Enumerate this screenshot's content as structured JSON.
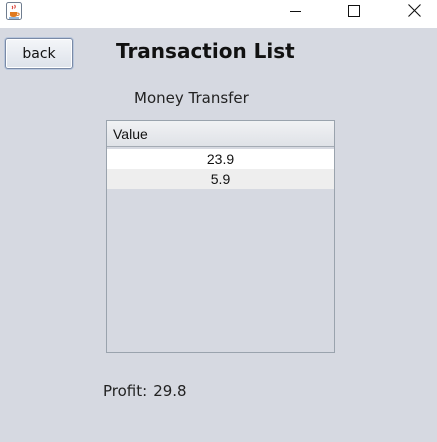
{
  "window": {
    "icon": "java-cup-icon",
    "controls": [
      "minimize-icon",
      "maximize-icon",
      "close-icon"
    ]
  },
  "toolbar": {
    "back_label": "back"
  },
  "header": {
    "title": "Transaction List",
    "subtitle": "Money Transfer"
  },
  "table": {
    "column": "Value",
    "rows": [
      "23.9",
      "5.9"
    ]
  },
  "summary": {
    "profit_label": "Profit:",
    "profit_value": "29.8"
  },
  "colors": {
    "background": "#d6d9e1",
    "titlebar": "#ffffff"
  }
}
